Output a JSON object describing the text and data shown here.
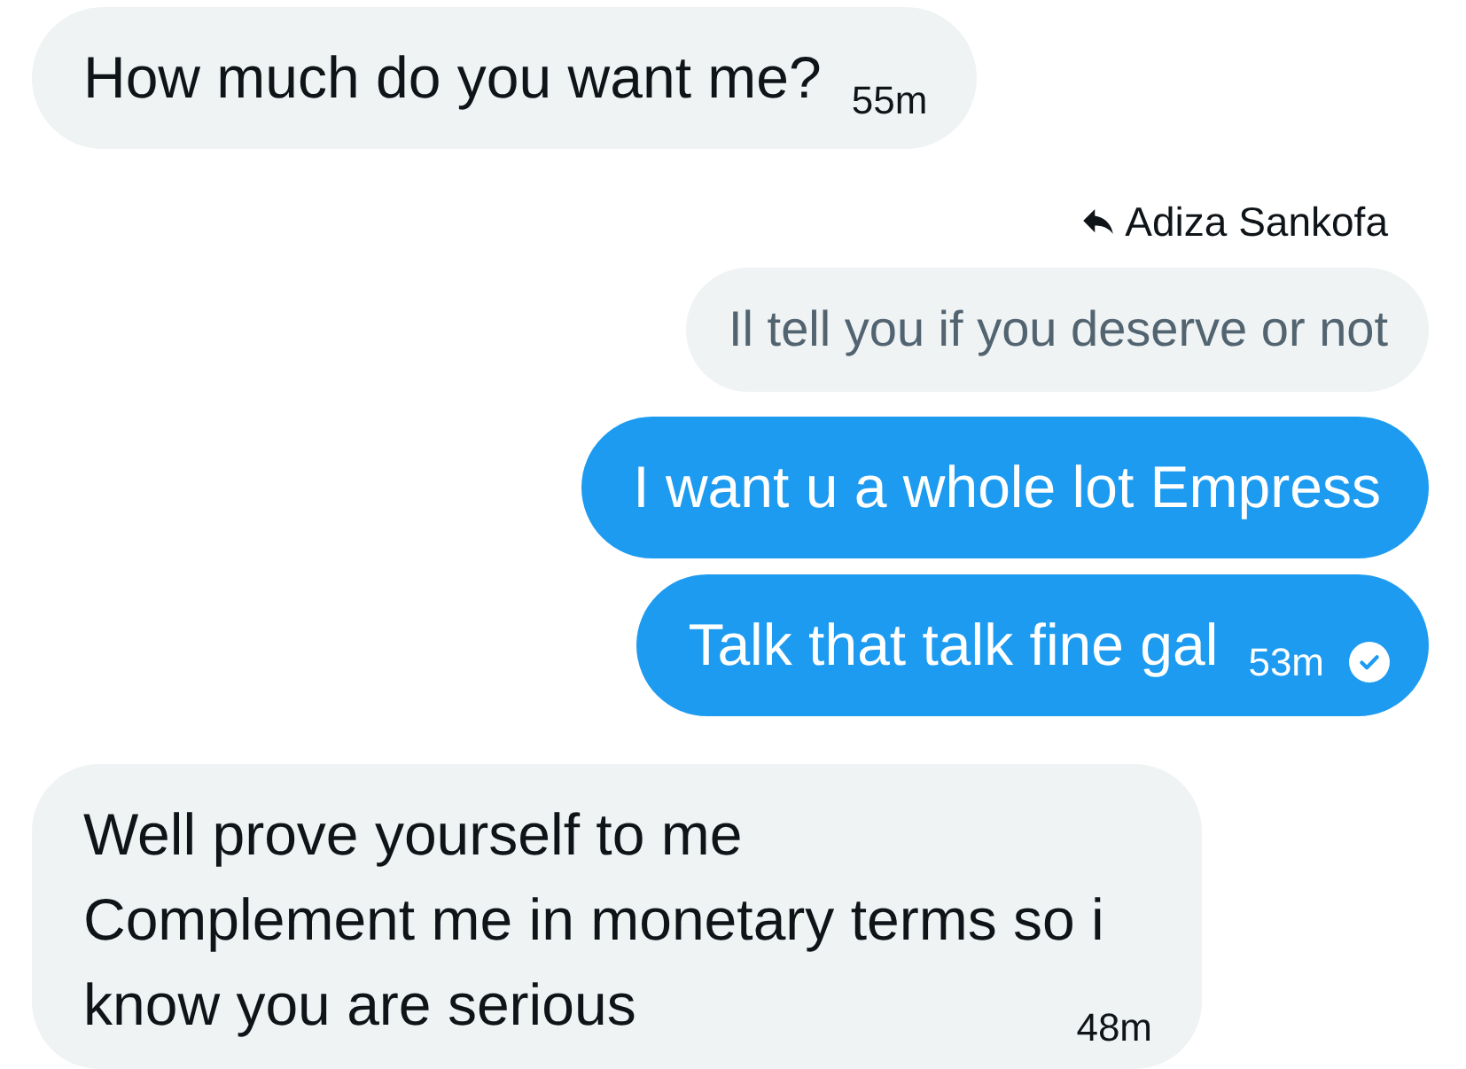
{
  "messages": [
    {
      "kind": "received",
      "lines": [
        "How much do you want me?"
      ],
      "time": "55m"
    },
    {
      "kind": "sent",
      "reply_to": {
        "name": "Adiza Sankofa",
        "text": "Il tell you if you deserve or not"
      },
      "lines": [
        "I want u a whole lot Empress"
      ]
    },
    {
      "kind": "sent",
      "lines": [
        "Talk that talk fine gal"
      ],
      "time": "53m",
      "seen": true
    },
    {
      "kind": "received",
      "lines": [
        "Well prove yourself to me",
        "Complement me in monetary terms so i",
        "know you are serious"
      ],
      "time": "48m"
    }
  ]
}
